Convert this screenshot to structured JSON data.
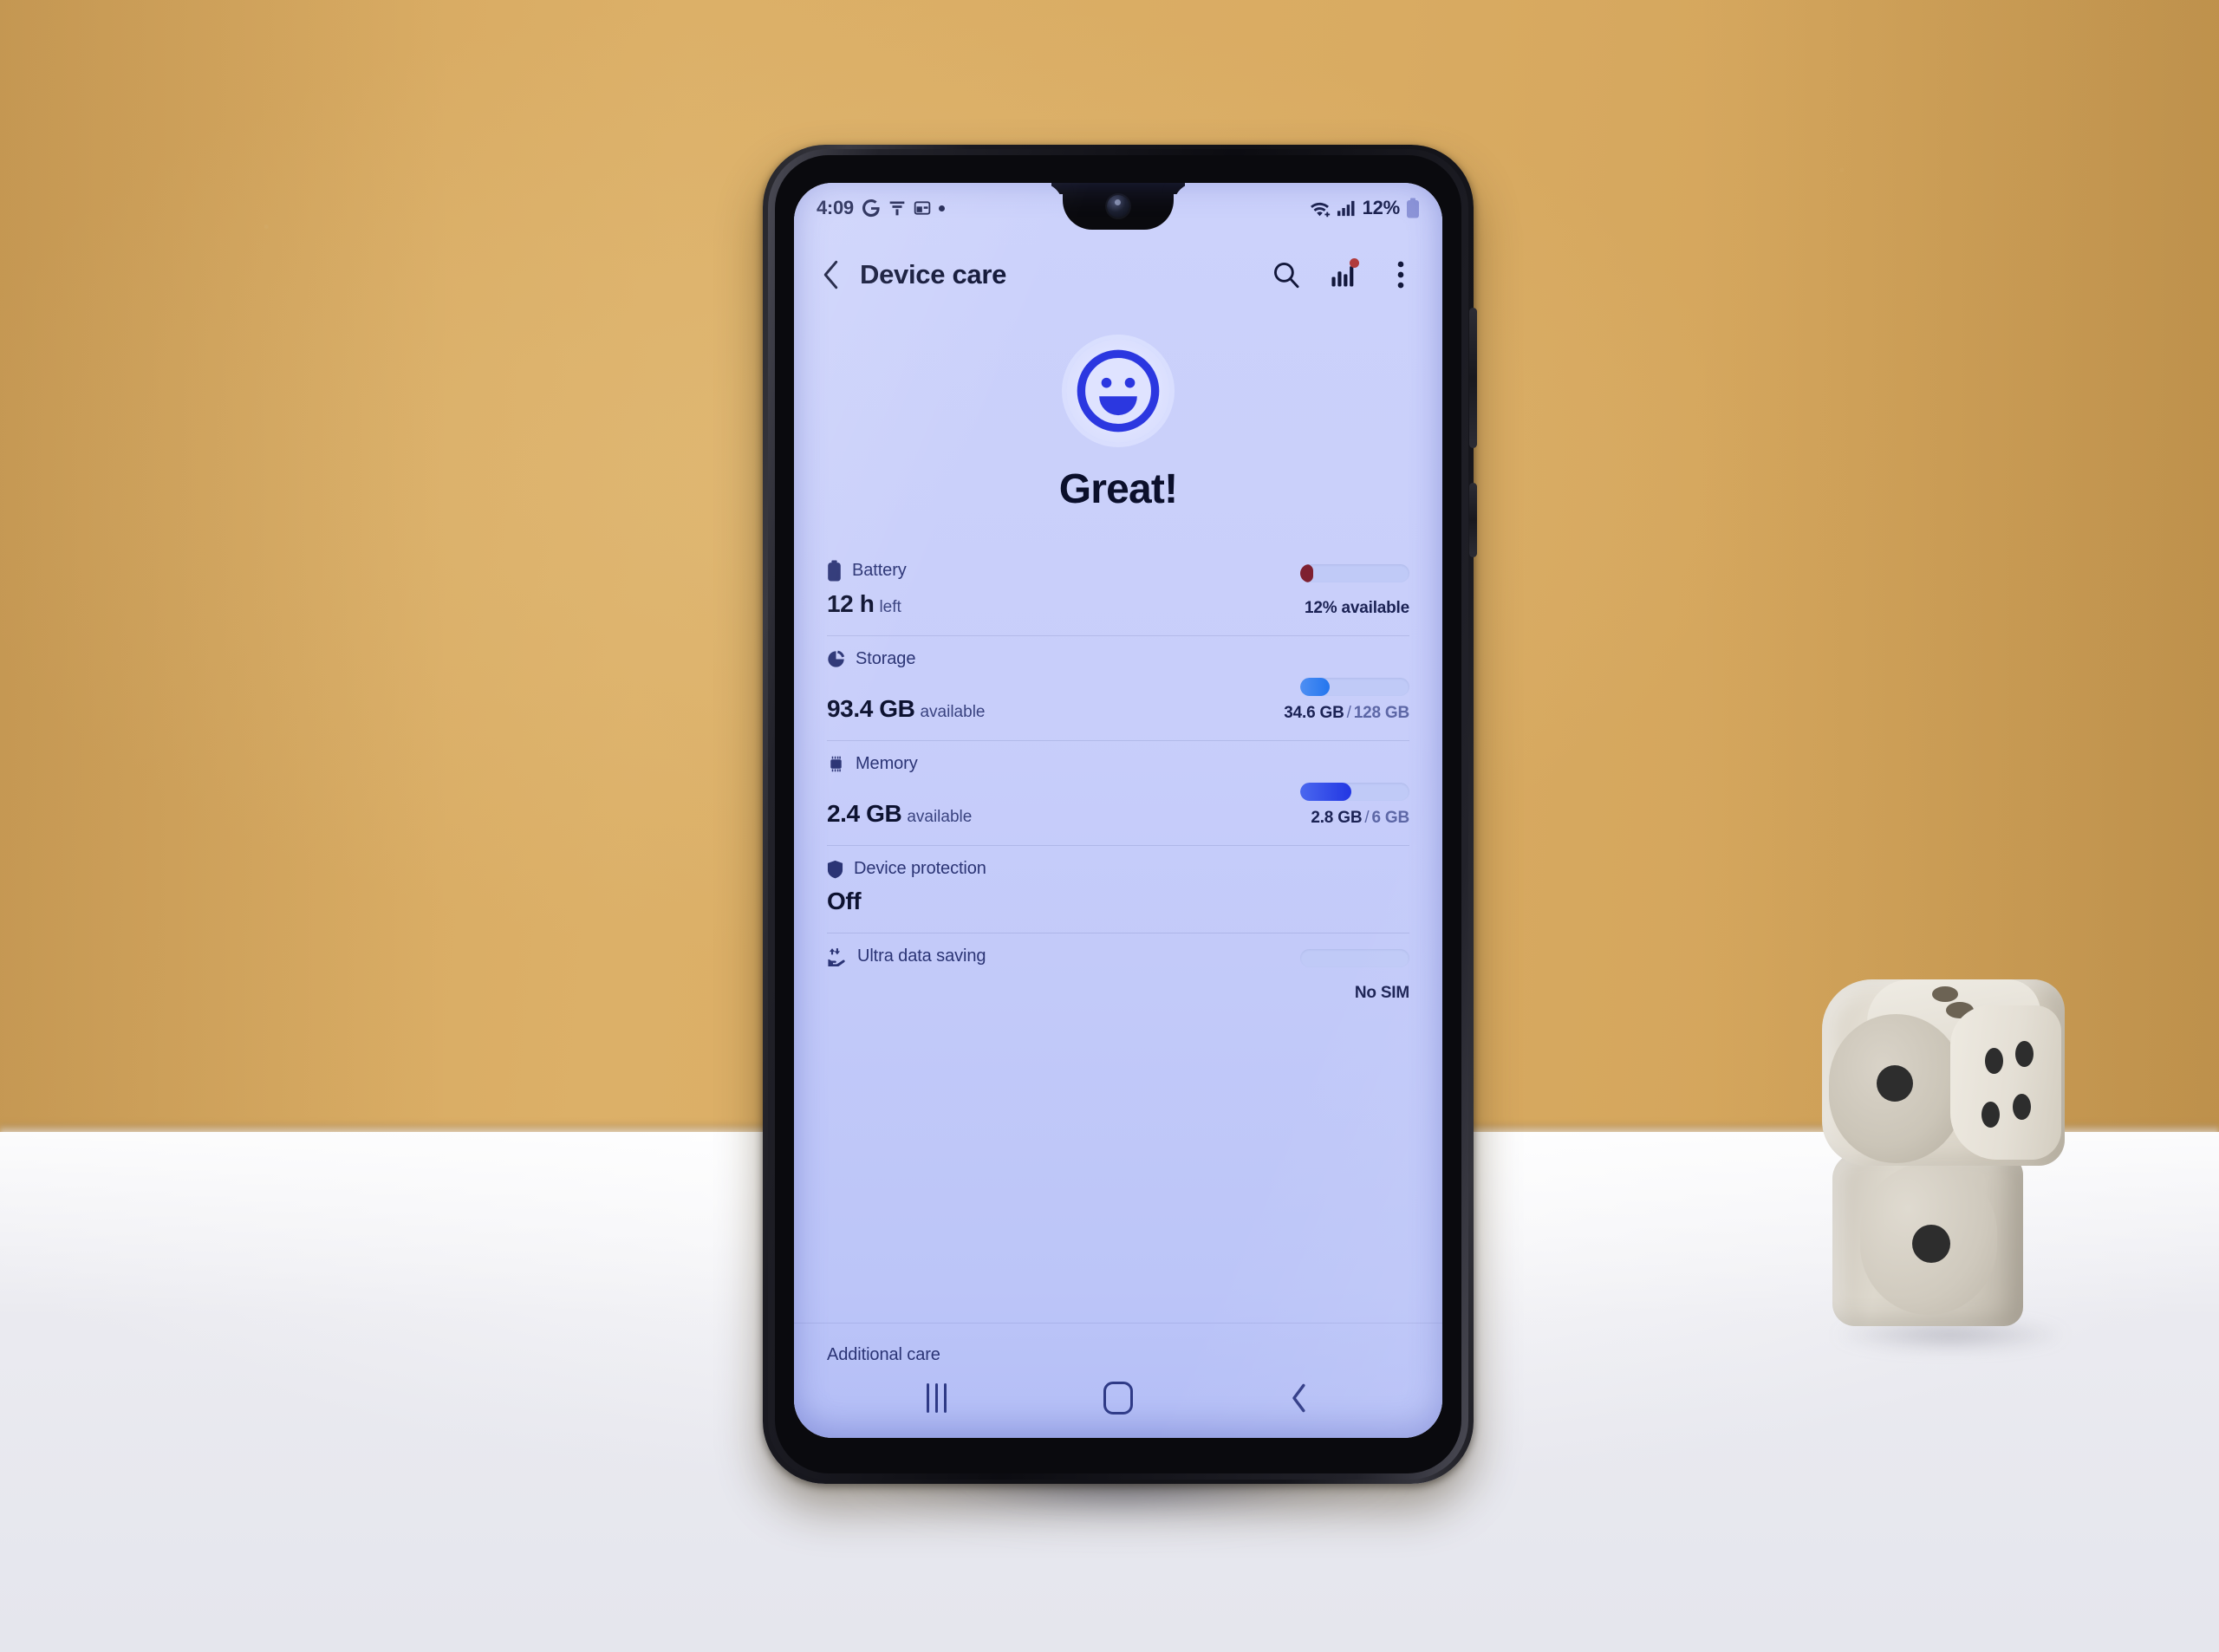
{
  "scene": {
    "description": "Smartphone on white table against mustard-yellow wall with two stacked wooden dice",
    "wall_color": "#d9ab62",
    "table_color": "#f2f2f6",
    "phone_body_color": "#16161c"
  },
  "dice": {
    "top_die": {
      "front_face_pips": 1,
      "right_face_pips": 4,
      "top_face_pips": 2
    },
    "bottom_die": {
      "front_face_pips": 1
    }
  },
  "phone": {
    "status_bar": {
      "time": "4:09",
      "left_icons": [
        "google-g-icon",
        "funnel-icon",
        "window-app-icon",
        "dot-icon"
      ],
      "right_icons": [
        "wifi-icon",
        "signal-bars-icon",
        "battery-icon"
      ],
      "battery_percent": "12%"
    },
    "app_bar": {
      "back_icon": "chevron-left-icon",
      "title": "Device care",
      "actions": [
        {
          "name": "search-icon",
          "label": "Search"
        },
        {
          "name": "usage-chart-icon",
          "label": "Usage",
          "badge": true
        },
        {
          "name": "more-options-icon",
          "label": "More options"
        }
      ]
    },
    "hero": {
      "face_icon": "smiley-face-icon",
      "title": "Great!",
      "accent_color": "#2b37e0"
    },
    "rows": [
      {
        "id": "battery",
        "icon": "battery-icon",
        "label": "Battery",
        "value": "12 h",
        "unit": "left",
        "bar_percent": 12,
        "bar_color": "#7e2030",
        "sub": "12% available",
        "sub_dim": "",
        "layout": "battery"
      },
      {
        "id": "storage",
        "icon": "storage-pie-icon",
        "label": "Storage",
        "value": "93.4 GB",
        "unit": "available",
        "bar_percent": 27,
        "bar_color": "#2f7ff0",
        "sub": "34.6 GB",
        "sub_dim": "128 GB",
        "layout": "standard"
      },
      {
        "id": "memory",
        "icon": "memory-chip-icon",
        "label": "Memory",
        "value": "2.4 GB",
        "unit": "available",
        "bar_percent": 47,
        "bar_color": "#2b46e6",
        "sub": "2.8 GB",
        "sub_dim": "6 GB",
        "layout": "standard"
      },
      {
        "id": "device-protection",
        "icon": "shield-icon",
        "label": "Device protection",
        "value": "Off",
        "unit": "",
        "bar_percent": null,
        "bar_color": "",
        "sub": "",
        "sub_dim": "",
        "layout": "novalue"
      },
      {
        "id": "ultra-data-saving",
        "icon": "data-saving-icon",
        "label": "Ultra data saving",
        "value": "",
        "unit": "",
        "bar_percent": 0,
        "bar_color": "",
        "sub": "No SIM",
        "sub_dim": "",
        "layout": "battery"
      }
    ],
    "additional_care": {
      "title": "Additional care"
    },
    "nav_bar": {
      "recents_label": "Recents",
      "home_label": "Home",
      "back_label": "Back"
    }
  }
}
